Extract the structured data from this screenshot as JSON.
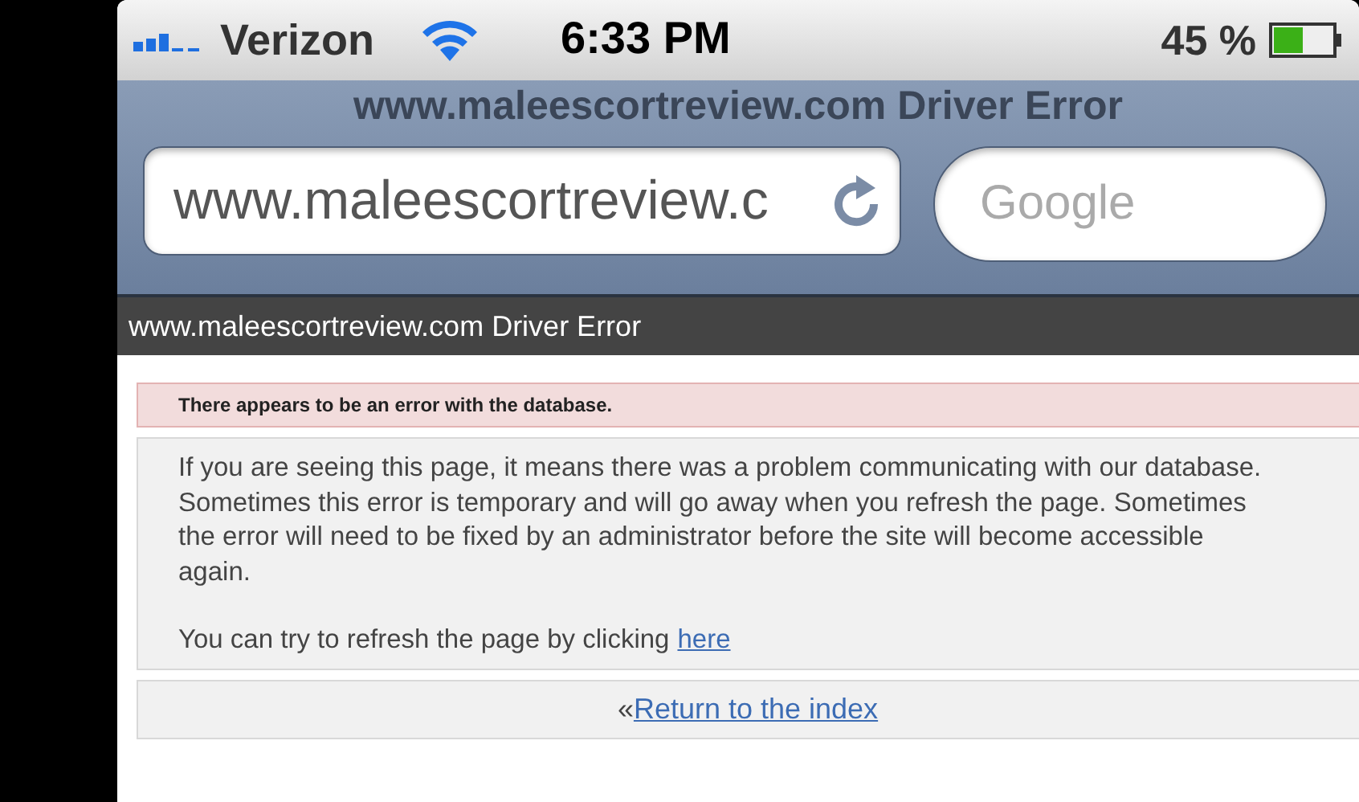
{
  "status_bar": {
    "carrier": "Verizon",
    "time": "6:33 PM",
    "battery": "45 %"
  },
  "browser": {
    "page_title": "www.maleescortreview.com Driver Error",
    "address": "www.maleescortreview.c",
    "search_placeholder": "Google"
  },
  "page": {
    "header": "www.maleescortreview.com Driver Error",
    "alert": "There appears to be an error with the database.",
    "message": "If you are seeing this page, it means there was a problem communicating with our database.\nSometimes this error is temporary and will go away when you refresh the page. Sometimes\nthe error will need to be fixed by an administrator before the site will become accessible\nagain.",
    "refresh_text": "You can try to refresh the page by clicking",
    "refresh_link": "here",
    "back_mark": "«",
    "back_link": "Return to the index"
  }
}
